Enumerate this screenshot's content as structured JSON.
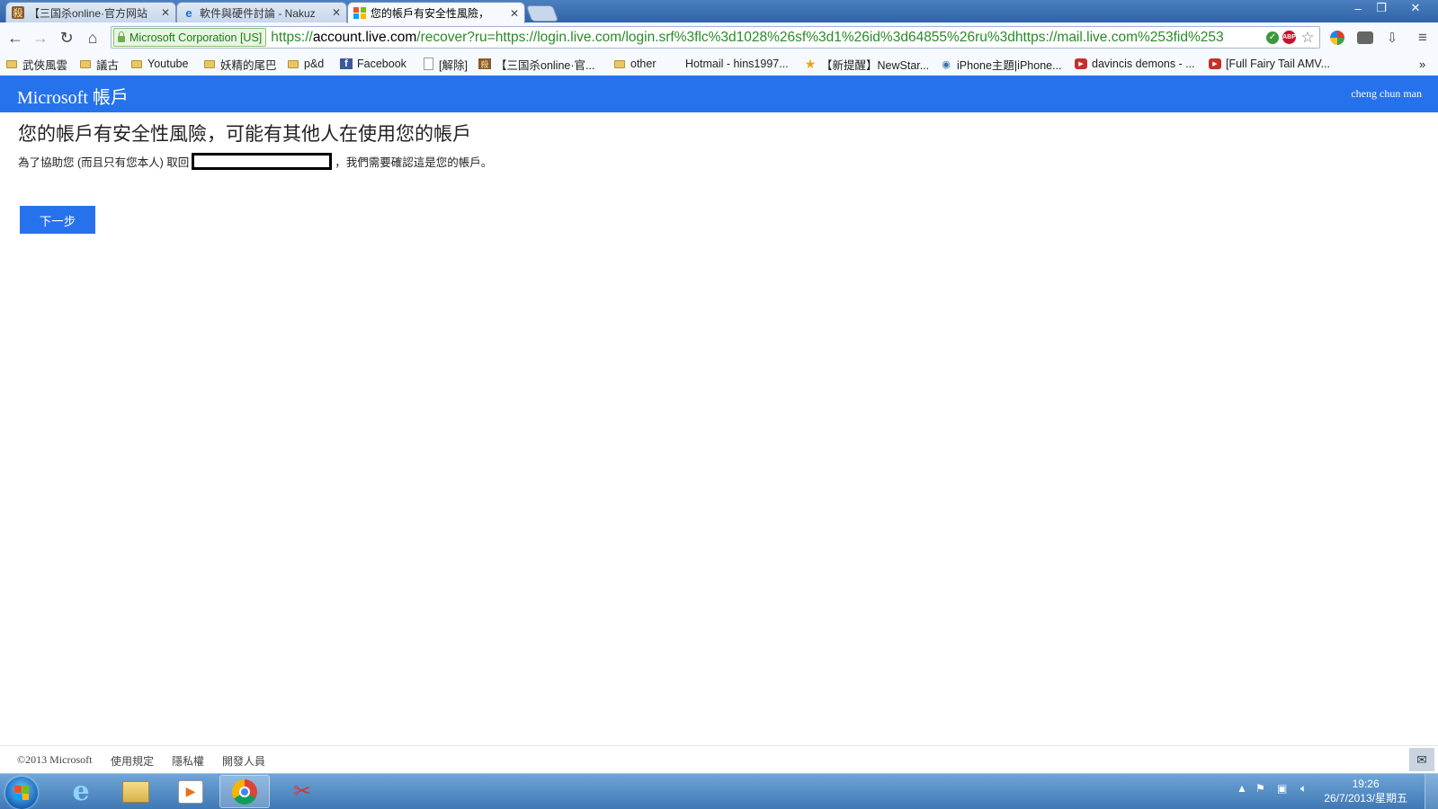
{
  "browser": {
    "tabs": [
      {
        "title": "【三国杀online·官方网站",
        "favicon": "sanguosha-icon"
      },
      {
        "title": "軟件與硬件討論 - Nakuz",
        "favicon": "ie-icon"
      },
      {
        "title": "您的帳戶有安全性風險，",
        "favicon": "microsoft-icon",
        "active": true
      }
    ],
    "window_controls": {
      "minimize": "–",
      "restore": "❐",
      "close": "✕"
    },
    "address_bar": {
      "ev_label": "Microsoft Corporation [US]",
      "url_scheme": "https://",
      "url_host": "account.live.com",
      "url_rest": "/recover?ru=https://login.live.com/login.srf%3flc%3d1028%26sf%3d1%26id%3d64855%26ru%3dhttps://mail.live.com%253fid%253"
    },
    "bookmarks": [
      {
        "label": "武俠風雲",
        "icon": "folder-icon"
      },
      {
        "label": "議古",
        "icon": "folder-icon"
      },
      {
        "label": "Youtube",
        "icon": "folder-icon"
      },
      {
        "label": "妖精的尾巴",
        "icon": "folder-icon"
      },
      {
        "label": "p&d",
        "icon": "folder-icon"
      },
      {
        "label": "Facebook",
        "icon": "facebook-icon"
      },
      {
        "label": "[解除]",
        "icon": "page-icon"
      },
      {
        "label": "【三国杀online·官...",
        "icon": "sanguosha-icon"
      },
      {
        "label": "other",
        "icon": "folder-icon"
      },
      {
        "label": "Hotmail - hins1997...",
        "icon": "windows-icon"
      },
      {
        "label": "【新提醒】NewStar...",
        "icon": "star-icon"
      },
      {
        "label": "iPhone主題|iPhone...",
        "icon": "iphone-site-icon"
      },
      {
        "label": "davincis demons - ...",
        "icon": "youtube-icon"
      },
      {
        "label": "[Full Fairy Tail AMV...",
        "icon": "youtube-icon"
      }
    ],
    "bookmarks_overflow": "»"
  },
  "header": {
    "brand": "Microsoft 帳戶",
    "user": "cheng chun man",
    "color": "#2672ec"
  },
  "main": {
    "title": "您的帳戶有安全性風險，可能有其他人在使用您的帳戶",
    "desc_before": "為了協助您 (而且只有您本人) 取回",
    "desc_after": "，我們需要確認這是您的帳戶。",
    "next_label": "下一步"
  },
  "footer": {
    "copyright": "©2013 Microsoft",
    "links": [
      "使用規定",
      "隱私權",
      "開發人員"
    ]
  },
  "taskbar": {
    "clock_time": "19:26",
    "clock_date": "26/7/2013/星期五"
  }
}
